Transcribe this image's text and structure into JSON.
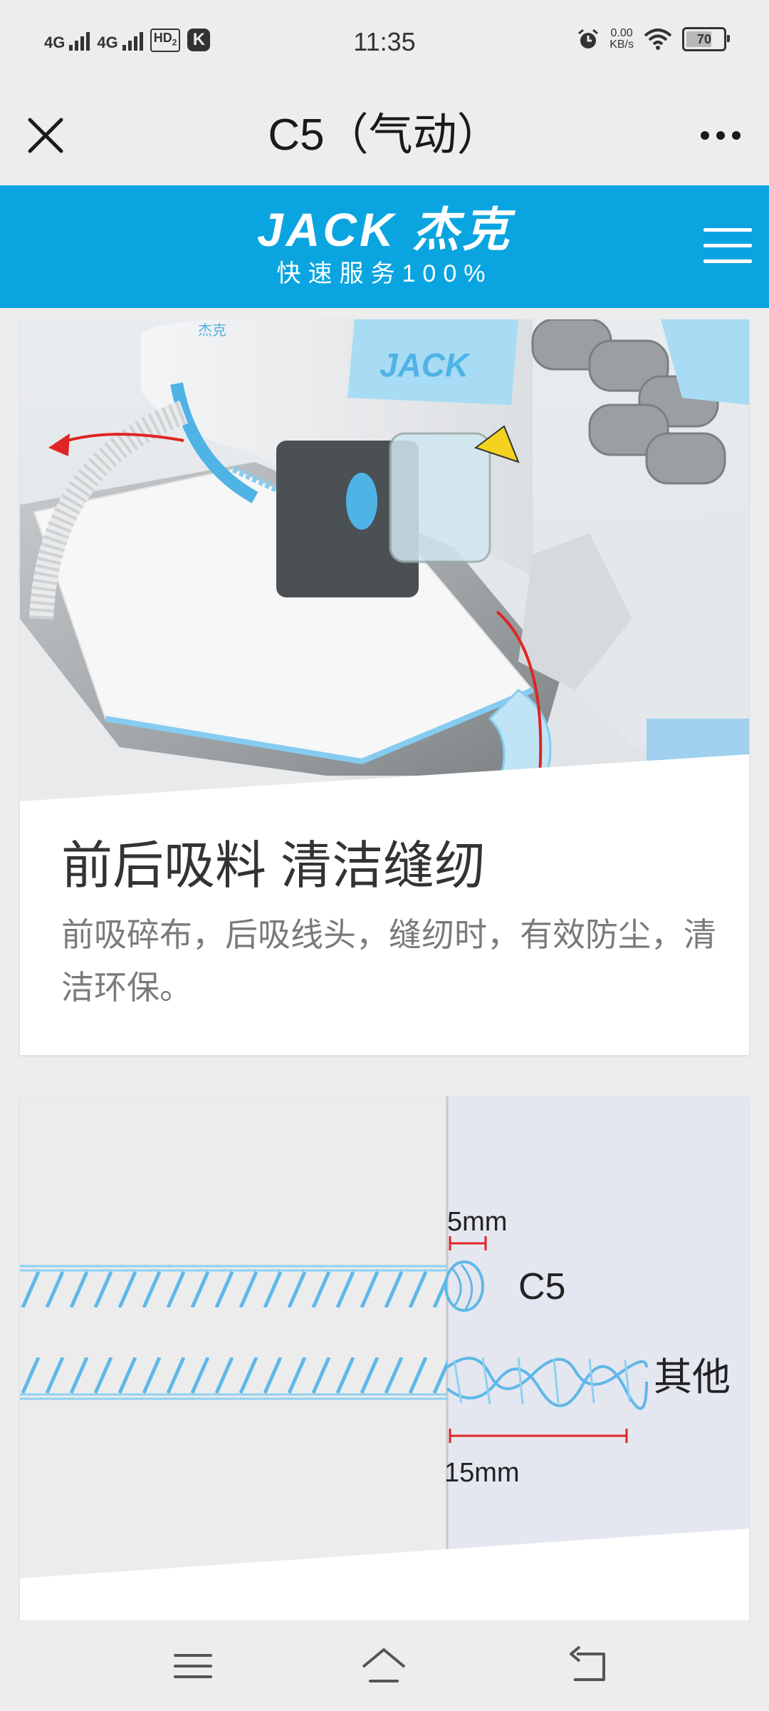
{
  "status_bar": {
    "sim1_gen": "4G",
    "sim2_gen": "4G",
    "hd_label": "HD",
    "hd_sub": "2",
    "app_badge": "K",
    "time": "11:35",
    "net_speed_value": "0.00",
    "net_speed_unit": "KB/s",
    "battery_level": "70",
    "icons": [
      "signal-icon",
      "hd-icon",
      "k-app-icon",
      "alarm-icon",
      "wifi-icon",
      "battery-icon"
    ]
  },
  "title_bar": {
    "title": "C5（气动）",
    "close_icon": "close-icon",
    "more_icon": "more-icon"
  },
  "brand": {
    "logo_text": "JACK 杰克",
    "slogan": "快速服务100%",
    "accent_color": "#0aa5e0",
    "menu_icon": "hamburger-menu-icon"
  },
  "cards": [
    {
      "title": "前后吸料 清洁缝纫",
      "description": "前吸碎布，后吸线头，缝纫时，有效防尘，清洁环保。",
      "image": {
        "machine_brand": "JACK",
        "machine_badge": "杰克"
      }
    },
    {
      "image": {
        "label_5mm": "5mm",
        "label_c5": "C5",
        "label_other": "其他",
        "label_15mm": "15mm"
      }
    }
  ],
  "nav_bar": {
    "icons": [
      "menu-nav-icon",
      "home-nav-icon",
      "back-nav-icon"
    ]
  }
}
